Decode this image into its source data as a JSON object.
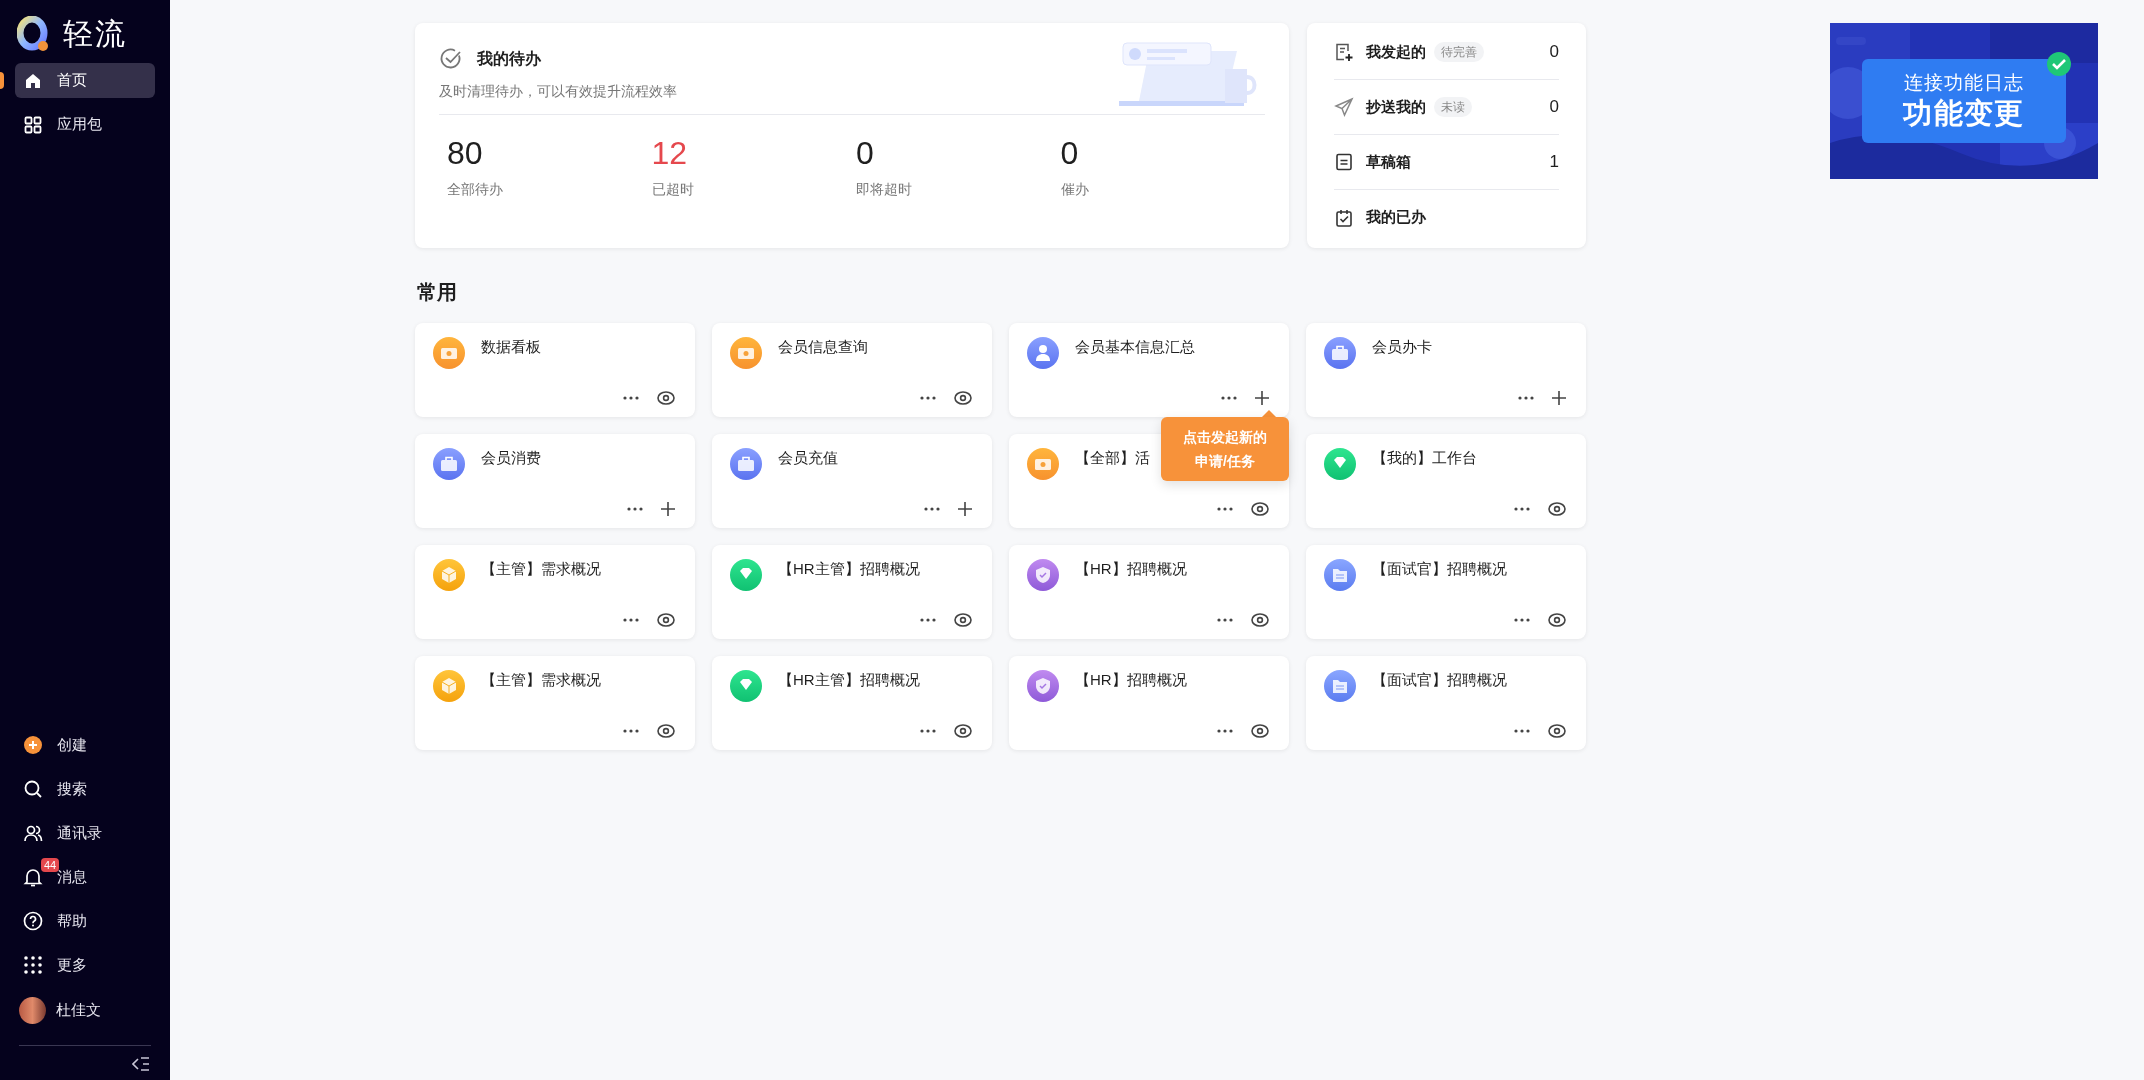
{
  "sidebar": {
    "logo": "轻流",
    "nav": [
      {
        "kind": "home",
        "label": "首页",
        "selected": true
      },
      {
        "kind": "apps",
        "label": "应用包",
        "selected": false
      }
    ],
    "bottom_nav": [
      {
        "kind": "create",
        "label": "创建"
      },
      {
        "kind": "search",
        "label": "搜索"
      },
      {
        "kind": "contacts",
        "label": "通讯录"
      },
      {
        "kind": "bell",
        "label": "消息",
        "badge": "44"
      },
      {
        "kind": "help",
        "label": "帮助"
      },
      {
        "kind": "grid",
        "label": "更多"
      }
    ],
    "user": {
      "name": "杜佳文"
    }
  },
  "todo": {
    "title": "我的待办",
    "subtitle": "及时清理待办，可以有效提升流程效率",
    "stats": [
      {
        "value": "80",
        "label": "全部待办",
        "color": "#1f1f1f"
      },
      {
        "value": "12",
        "label": "已超时",
        "color": "#e5484d"
      },
      {
        "value": "0",
        "label": "即将超时",
        "color": "#1f1f1f"
      },
      {
        "value": "0",
        "label": "催办",
        "color": "#1f1f1f"
      }
    ]
  },
  "summary": [
    {
      "kind": "started",
      "label": "我发起的",
      "tag": "待完善",
      "count": "0"
    },
    {
      "kind": "cc",
      "label": "抄送我的",
      "tag": "未读",
      "count": "0"
    },
    {
      "kind": "draft",
      "label": "草稿箱",
      "count": "1"
    },
    {
      "kind": "done",
      "label": "我的已办"
    }
  ],
  "banner": {
    "line1": "连接功能日志",
    "line2": "功能变更"
  },
  "frequent": {
    "title": "常用",
    "apps": [
      {
        "kind": "coin",
        "title": "数据看板",
        "actions": [
          {
            "kind": "more"
          },
          {
            "kind": "view"
          }
        ]
      },
      {
        "kind": "coin",
        "title": "会员信息查询",
        "actions": [
          {
            "kind": "more"
          },
          {
            "kind": "view"
          }
        ]
      },
      {
        "kind": "person",
        "title": "会员基本信息汇总",
        "actions": [
          {
            "kind": "more"
          },
          {
            "kind": "add"
          }
        ],
        "tooltip": "点击发起新的申请/任务"
      },
      {
        "kind": "briefcase",
        "title": "会员办卡",
        "actions": [
          {
            "kind": "more"
          },
          {
            "kind": "add"
          }
        ]
      },
      {
        "kind": "briefcase",
        "title": "会员消费",
        "actions": [
          {
            "kind": "more"
          },
          {
            "kind": "add"
          }
        ]
      },
      {
        "kind": "briefcase",
        "title": "会员充值",
        "actions": [
          {
            "kind": "more"
          },
          {
            "kind": "add"
          }
        ]
      },
      {
        "kind": "coin",
        "title": "【全部】活",
        "actions": [
          {
            "kind": "more"
          },
          {
            "kind": "view"
          }
        ]
      },
      {
        "kind": "gem",
        "title": "【我的】工作台",
        "actions": [
          {
            "kind": "more"
          },
          {
            "kind": "view"
          }
        ]
      },
      {
        "kind": "cube",
        "title": "【主管】需求概况",
        "actions": [
          {
            "kind": "more"
          },
          {
            "kind": "view"
          }
        ]
      },
      {
        "kind": "gem",
        "title": "【HR主管】招聘概况",
        "actions": [
          {
            "kind": "more"
          },
          {
            "kind": "view"
          }
        ]
      },
      {
        "kind": "shield",
        "title": "【HR】招聘概况",
        "actions": [
          {
            "kind": "more"
          },
          {
            "kind": "view"
          }
        ]
      },
      {
        "kind": "folder",
        "title": "【面试官】招聘概况",
        "actions": [
          {
            "kind": "more"
          },
          {
            "kind": "view"
          }
        ]
      },
      {
        "kind": "cube",
        "title": "【主管】需求概况",
        "actions": [
          {
            "kind": "more"
          },
          {
            "kind": "view"
          }
        ]
      },
      {
        "kind": "gem",
        "title": "【HR主管】招聘概况",
        "actions": [
          {
            "kind": "more"
          },
          {
            "kind": "view"
          }
        ]
      },
      {
        "kind": "shield",
        "title": "【HR】招聘概况",
        "actions": [
          {
            "kind": "more"
          },
          {
            "kind": "view"
          }
        ]
      },
      {
        "kind": "folder",
        "title": "【面试官】招聘概况",
        "actions": [
          {
            "kind": "more"
          },
          {
            "kind": "view"
          }
        ]
      }
    ]
  }
}
